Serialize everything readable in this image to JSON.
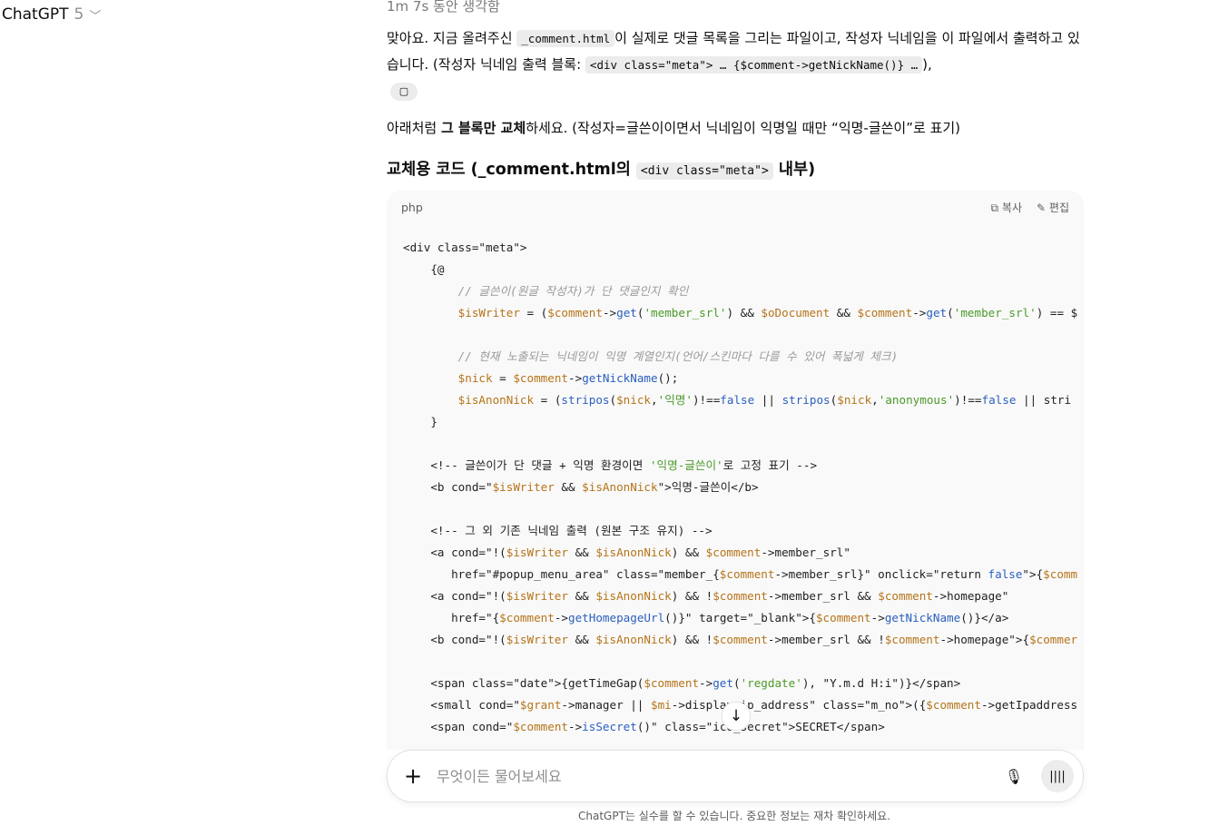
{
  "header": {
    "model_name": "ChatGPT",
    "model_version": "5",
    "chevron_icon": "chevron-down-icon"
  },
  "thought": {
    "label": "1m 7s 동안 생각함"
  },
  "message": {
    "p1_part1": "맞아요. 지금 올려주신 ",
    "p1_code1": "_comment.html",
    "p1_part2": "이 실제로 댓글 목록을 그리는 파일이고, 작성자 닉네임을 이 파일에서 출력하고 있습니다. (작성자 닉네임 출력 블록: ",
    "p1_code2": "<div class=\"meta\"> … {$comment->getNickName()} …",
    "p1_part3": "),",
    "copy_icon": "document-icon",
    "p2_part1": "아래처럼 ",
    "p2_bold": "그 블록만 교체",
    "p2_part2": "하세요. (작성자=글쓴이이면서 닉네임이 익명일 때만 “익명-글쓴이”로 표기)",
    "h3_part1": "교체용 코드 (_comment.html의 ",
    "h3_code": "<div class=\"meta\">",
    "h3_part2": " 내부)"
  },
  "code_block": {
    "language": "php",
    "copy_label": "복사",
    "edit_label": "편집",
    "lines": [
      "<div class=\"meta\">",
      "    {@",
      "        // 글쓴이(원글 작성자)가 단 댓글인지 확인",
      "        $isWriter = ($comment->get('member_srl') && $oDocument && $comment->get('member_srl') == $",
      "",
      "        // 현재 노출되는 닉네임이 익명 계열인지(언어/스킨마다 다를 수 있어 폭넓게 체크)",
      "        $nick = $comment->getNickName();",
      "        $isAnonNick = (stripos($nick,'익명')!==false || stripos($nick,'anonymous')!==false || stri",
      "    }",
      "",
      "    <!-- 글쓴이가 단 댓글 + 익명 환경이면 '익명-글쓴이'로 고정 표기 -->",
      "    <b cond=\"$isWriter && $isAnonNick\">익명-글쓴이</b>",
      "",
      "    <!-- 그 외 기존 닉네임 출력 (원본 구조 유지) -->",
      "    <a cond=\"!($isWriter && $isAnonNick) && $comment->member_srl\"",
      "       href=\"#popup_menu_area\" class=\"member_{$comment->member_srl}\" onclick=\"return false\">{$comm",
      "    <a cond=\"!($isWriter && $isAnonNick) && !$comment->member_srl && $comment->homepage\"",
      "       href=\"{$comment->getHomepageUrl()}\" target=\"_blank\">{$comment->getNickName()}</a>",
      "    <b cond=\"!($isWriter && $isAnonNick) && !$comment->member_srl && !$comment->homepage\">{$commer",
      "",
      "    <span class=\"date\">{getTimeGap($comment->get('regdate'), \"Y.m.d H:i\")}</span>",
      "    <small cond=\"$grant->manager || $mi->display_ip_address\" class=\"m_no\">({$comment->getIpaddress",
      "    <span cond=\"$comment->isSecret()\" class=\"ico_secret\">SECRET</span>"
    ]
  },
  "composer": {
    "placeholder": "무엇이든 물어보세요"
  },
  "footer": {
    "disclaimer": "ChatGPT는 실수를 할 수 있습니다. 중요한 정보는 재차 확인하세요."
  }
}
